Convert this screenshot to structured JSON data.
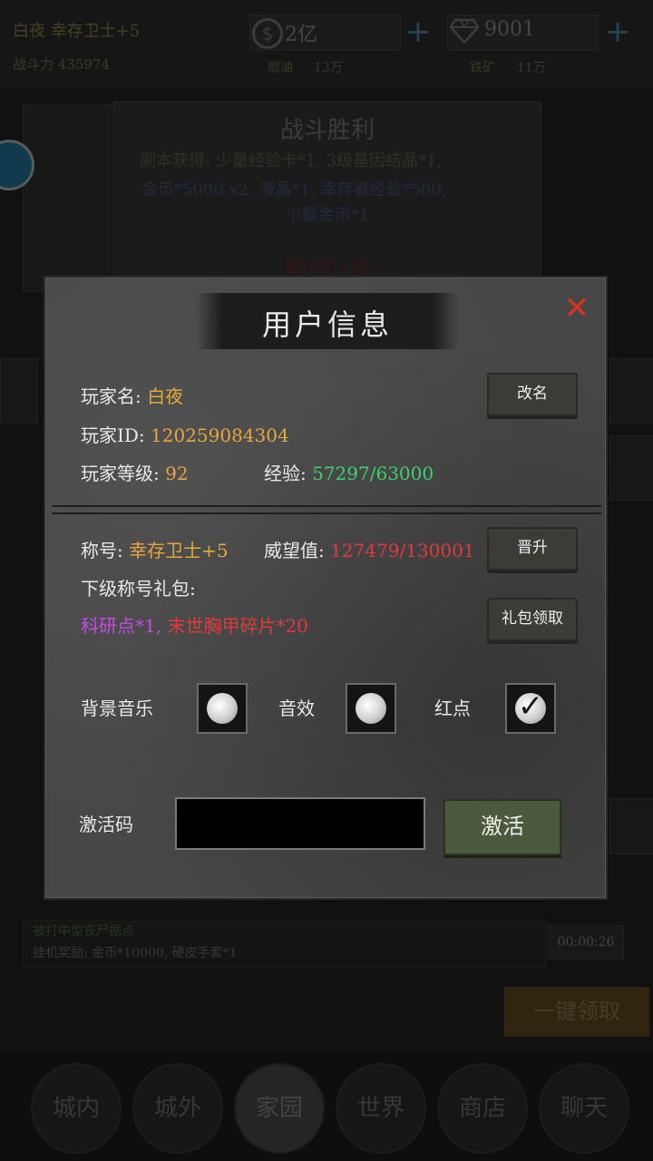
{
  "background": {
    "player_header": {
      "name_line": "白夜  幸存卫士+5",
      "power_line": "战斗力  435974"
    },
    "resources": {
      "coins": "2亿",
      "diamonds": "9001",
      "fuel_label": "燃油",
      "fuel_value": "13万",
      "iron_label": "铁矿",
      "iron_value": "11万"
    },
    "victory_panel": {
      "title": "战斗胜利",
      "line1": "副本获得: 少量经验卡*1, 3级基因结晶*1,",
      "line2": "金币*5000 x2, 液晶*1, 幸存者经验*500,",
      "line3": "小额金币*1",
      "countdown": "倒计时 3 秒"
    },
    "idle_reward": {
      "line1": "被打中型丧尸据点",
      "line2": "挂机奖励: 金币*10000, 硬皮手套*1",
      "timer": "00:00:26"
    },
    "claim_all": "一键领取",
    "nav": [
      "城内",
      "城外",
      "家园",
      "世界",
      "商店",
      "聊天"
    ]
  },
  "modal": {
    "title": "用户信息",
    "player_name_label": "玩家名: ",
    "player_name": "白夜",
    "player_id_label": "玩家ID: ",
    "player_id": "120259084304",
    "level_label": "玩家等级: ",
    "level": "92",
    "exp_label": "经验: ",
    "exp": "57297/63000",
    "rename_button": "改名",
    "rank_label": "称号: ",
    "rank": "幸存卫士+5",
    "prestige_label": "威望值: ",
    "prestige": "127479/130001",
    "promote_button": "晋升",
    "next_gift_label": "下级称号礼包:",
    "gift_item1": "科研点*1, ",
    "gift_item2": "末世胸甲碎片*20",
    "claim_gift_button": "礼包领取",
    "settings": {
      "music_label": "背景音乐",
      "sfx_label": "音效",
      "reddot_label": "红点",
      "music_on": false,
      "sfx_on": false,
      "reddot_on": true
    },
    "activation": {
      "label": "激活码",
      "value": "",
      "button": "激活"
    }
  },
  "colors": {
    "orange": "#e5a83a",
    "green": "#3ed16b",
    "red": "#e03b3b",
    "purple": "#c24fe0",
    "close": "#d8331e"
  }
}
